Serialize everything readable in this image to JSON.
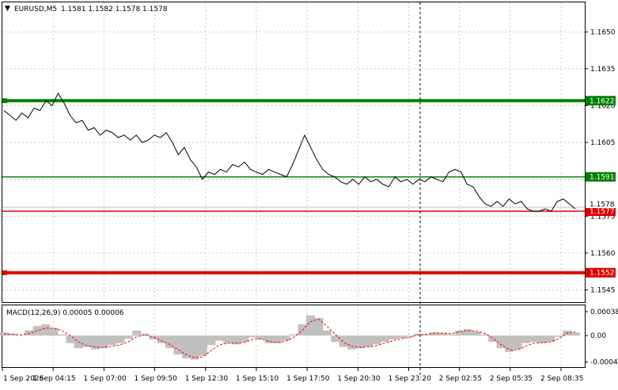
{
  "header": {
    "dropdown_glyph": "▼",
    "symbol": "EURUSD,M5",
    "quote": "1.1581 1.1582 1.1578 1.1578"
  },
  "price_axis": {
    "min": 1.154,
    "max": 1.1662,
    "ticks": [
      "1.1650",
      "1.1635",
      "1.1620",
      "1.1605",
      "1.1590",
      "1.1575",
      "1.1560",
      "1.1545"
    ],
    "tick_values": [
      1.165,
      1.1635,
      1.162,
      1.1605,
      1.159,
      1.1575,
      1.156,
      1.1545
    ]
  },
  "levels": [
    {
      "name": "resistance-strong",
      "value": 1.1622,
      "label": "1.1622",
      "color": "#008000",
      "thick": true
    },
    {
      "name": "resistance",
      "value": 1.1591,
      "label": "1.1591",
      "color": "#008000",
      "thick": false
    },
    {
      "name": "support",
      "value": 1.1577,
      "label": "1.1577",
      "color": "#e00000",
      "thick": false
    },
    {
      "name": "support-strong",
      "value": 1.1552,
      "label": "1.1552",
      "color": "#e00000",
      "thick": true
    }
  ],
  "current_price": {
    "value": 1.1578,
    "label": "1.1578",
    "line_color": "#c0c0c0"
  },
  "time_axis": {
    "labels": [
      "1 Sep 2026",
      "1 Sep 04:15",
      "1 Sep 07:00",
      "1 Sep 09:50",
      "1 Sep 12:30",
      "1 Sep 15:10",
      "1 Sep 17:50",
      "1 Sep 20:30",
      "1 Sep 23:20",
      "2 Sep 02:55",
      "2 Sep 05:35",
      "2 Sep 08:35"
    ]
  },
  "macd": {
    "label": "MACD(12,26,9) 0.00005 0.00006",
    "min": -0.0005,
    "max": 0.00048,
    "ticks": [
      "0.00038",
      "0.00",
      "-0.00042"
    ],
    "tick_values": [
      0.00038,
      0.0,
      -0.00042
    ],
    "histogram_color": "#c0c0c0",
    "signal_color": "#ff0000"
  },
  "chart_data": {
    "type": "line",
    "title": "EURUSD,M5",
    "series": [
      {
        "name": "EURUSD,M5",
        "values": [
          1.1618,
          1.1616,
          1.1614,
          1.1617,
          1.1615,
          1.1619,
          1.1618,
          1.1622,
          1.162,
          1.1625,
          1.1621,
          1.1616,
          1.1613,
          1.1614,
          1.161,
          1.1611,
          1.1608,
          1.161,
          1.1609,
          1.1607,
          1.1608,
          1.1606,
          1.1608,
          1.1605,
          1.1606,
          1.1608,
          1.1607,
          1.1609,
          1.1605,
          1.16,
          1.1603,
          1.1598,
          1.1595,
          1.159,
          1.1593,
          1.1592,
          1.1594,
          1.1593,
          1.1596,
          1.1595,
          1.1597,
          1.1594,
          1.1593,
          1.1592,
          1.1594,
          1.1593,
          1.1592,
          1.1591,
          1.1596,
          1.1602,
          1.1608,
          1.1603,
          1.1598,
          1.1594,
          1.1592,
          1.1591,
          1.1589,
          1.1588,
          1.159,
          1.1588,
          1.1591,
          1.1589,
          1.159,
          1.1588,
          1.1587,
          1.1591,
          1.1589,
          1.159,
          1.1588,
          1.159,
          1.1589,
          1.1591,
          1.159,
          1.1589,
          1.1593,
          1.1594,
          1.1593,
          1.1588,
          1.1587,
          1.1583,
          1.158,
          1.1579,
          1.1581,
          1.1579,
          1.1582,
          1.158,
          1.1581,
          1.1578,
          1.1577,
          1.1577,
          1.1578,
          1.1577,
          1.1581,
          1.1582,
          1.158,
          1.1578
        ]
      }
    ],
    "macd_main": [
      5e-05,
      3e-05,
      0.0,
      8e-05,
      0.00015,
      0.00018,
      0.00012,
      2e-05,
      -0.00012,
      -0.0002,
      -0.00018,
      -0.00022,
      -0.0002,
      -0.00015,
      -0.00012,
      -5e-05,
      8e-05,
      3e-05,
      -6e-05,
      -0.00012,
      -0.0002,
      -0.0003,
      -0.00036,
      -0.00038,
      -0.00032,
      -0.00015,
      -8e-05,
      -0.00012,
      -0.00014,
      -0.0001,
      -3e-05,
      -6e-05,
      -0.00012,
      -0.00012,
      -8e-05,
      2e-05,
      0.00018,
      0.00032,
      0.00028,
      8e-05,
      -0.0001,
      -0.00018,
      -0.00022,
      -0.0002,
      -0.00018,
      -0.00014,
      -0.0001,
      -6e-05,
      -4e-05,
      -2e-05,
      3e-05,
      2e-05,
      5e-05,
      4e-05,
      2e-05,
      8e-05,
      0.0001,
      6e-05,
      2e-05,
      -0.0001,
      -0.0002,
      -0.00026,
      -0.00022,
      -0.00012,
      -0.0001,
      -0.00012,
      -0.0001,
      -2e-05,
      8e-05,
      5e-05
    ],
    "macd_signal": [
      2e-05,
      2e-05,
      1e-05,
      3e-05,
      8e-05,
      0.00012,
      0.00012,
      8e-05,
      0.0,
      -0.0001,
      -0.00016,
      -0.00018,
      -0.00019,
      -0.00017,
      -0.00015,
      -0.0001,
      -2e-05,
      1e-05,
      -2e-05,
      -8e-05,
      -0.00014,
      -0.00022,
      -0.0003,
      -0.00035,
      -0.00034,
      -0.00024,
      -0.00015,
      -0.00012,
      -0.00012,
      -0.00011,
      -6e-05,
      -5e-05,
      -9e-05,
      -0.00011,
      -9e-05,
      -3e-05,
      8e-05,
      0.00022,
      0.00026,
      0.00015,
      2e-05,
      -0.0001,
      -0.00017,
      -0.00019,
      -0.00018,
      -0.00016,
      -0.00012,
      -8e-05,
      -5e-05,
      -3e-05,
      1e-05,
      2e-05,
      4e-05,
      4e-05,
      3e-05,
      6e-05,
      8e-05,
      7e-05,
      4e-05,
      -4e-05,
      -0.00014,
      -0.00022,
      -0.00023,
      -0.00017,
      -0.00012,
      -0.00011,
      -0.0001,
      -5e-05,
      4e-05,
      6e-05
    ]
  }
}
